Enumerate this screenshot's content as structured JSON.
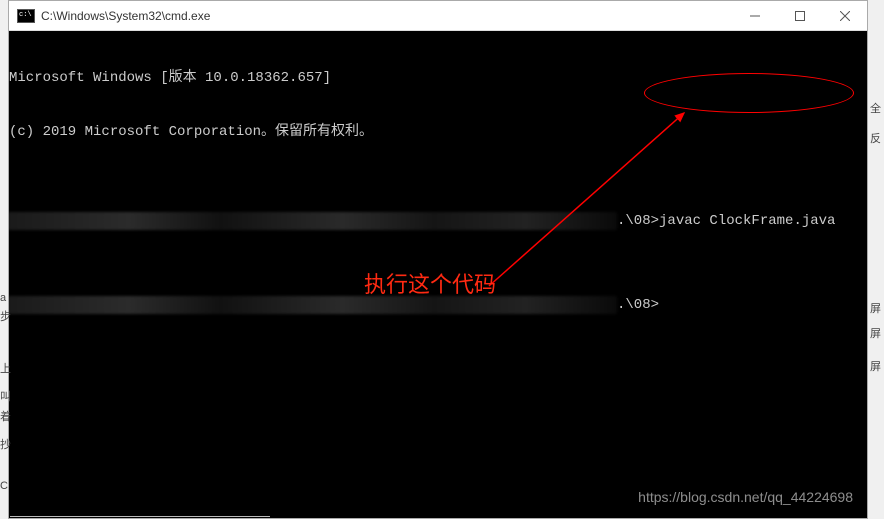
{
  "window": {
    "title": "C:\\Windows\\System32\\cmd.exe"
  },
  "terminal": {
    "line1": "Microsoft Windows [版本 10.0.18362.657]",
    "line2": "(c) 2019 Microsoft Corporation。保留所有权利。",
    "prompt1_path_suffix": ".\\08>",
    "prompt1_command": "javac ClockFrame.java",
    "prompt2_path_suffix": ".\\08>"
  },
  "annotation": {
    "label": "执行这个代码"
  },
  "watermark": {
    "text": "https://blog.csdn.net/qq_44224698"
  },
  "side": {
    "s1": "全",
    "s2": "反",
    "s3": "屏",
    "s4": "屏",
    "s5": "屏"
  },
  "left": {
    "l1": "a",
    "l2": "步",
    "l3": "上",
    "l4": "叫",
    "l5": "着",
    "l6": "抄",
    "l7": "C"
  }
}
